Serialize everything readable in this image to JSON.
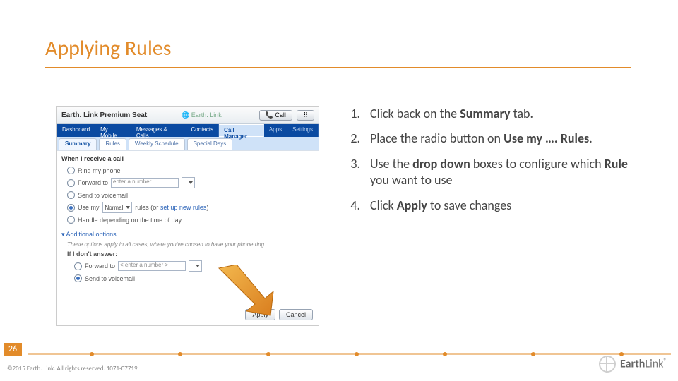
{
  "title": "Applying Rules",
  "page_number": "26",
  "copyright": "©2015 Earth. Link. All rights reserved. 1071-07719",
  "logo": {
    "brand_a": "Earth",
    "brand_b": "Link"
  },
  "figure": {
    "brand": "Earth. Link Premium Seat",
    "mini_brand": "Earth. Link",
    "btn_call": "Call",
    "nav": {
      "dashboard": "Dashboard",
      "my_mobile": "My Mobile",
      "messages": "Messages & Calls",
      "contacts": "Contacts",
      "call_manager": "Call Manager",
      "apps": "Apps",
      "settings": "Settings"
    },
    "subtabs": {
      "summary": "Summary",
      "rules": "Rules",
      "weekly": "Weekly Schedule",
      "special": "Special Days"
    },
    "panel": {
      "heading": "When I receive a call",
      "ring_my_phone": "Ring my phone",
      "forward_to": "Forward to",
      "forward_placeholder": "enter a number",
      "send_voicemail": "Send to voicemail",
      "use_my": "Use my",
      "use_my_select": "Normal",
      "rules_link_prefix": "rules (or ",
      "rules_link": "set up new rules",
      "rules_link_suffix": ")",
      "handle_day": "Handle depending on the time of day",
      "additional": "▾ Additional options",
      "note": "These options apply in all cases, where you've chosen to have your phone ring",
      "if_dont_answer": "If I don't answer:",
      "forward_to2": "Forward to",
      "forward2_placeholder": "< enter a number >",
      "send_voicemail2": "Send to voicemail",
      "apply": "Apply",
      "cancel": "Cancel"
    }
  },
  "instructions": [
    {
      "num": "1.",
      "t1": "Click back on the ",
      "b1": "Summary",
      "t2": " tab."
    },
    {
      "num": "2.",
      "t1": "Place the radio button on ",
      "b1": "Use my …. Rules",
      "t2": "."
    },
    {
      "num": "3.",
      "t1": "Use the ",
      "b1": "drop down",
      "t2": " boxes to configure which ",
      "b2": "Rule",
      "t3": " you want to use"
    },
    {
      "num": "4.",
      "t1": "Click ",
      "b1": "Apply",
      "t2": " to save changes"
    }
  ]
}
